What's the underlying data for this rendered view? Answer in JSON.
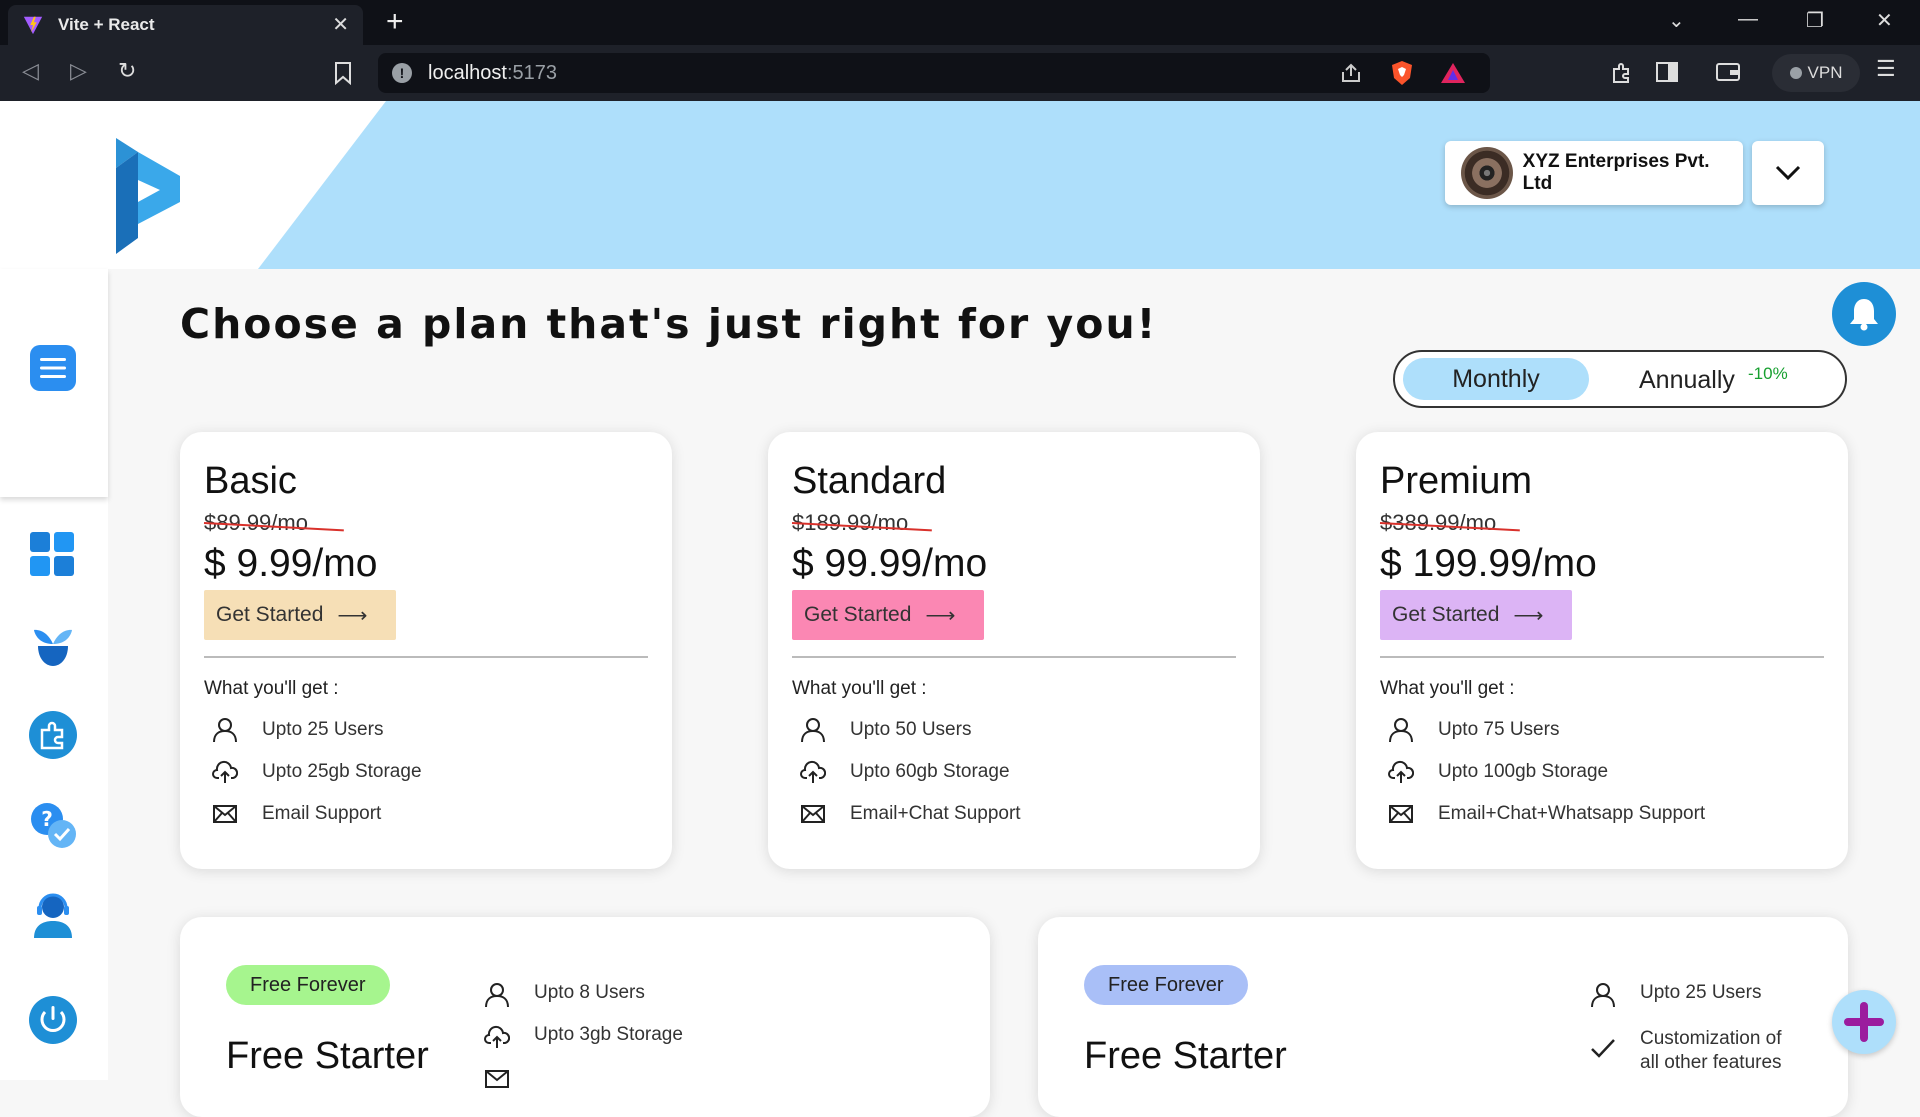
{
  "browser": {
    "tab_title": "Vite + React",
    "url_host": "localhost",
    "url_port": ":5173",
    "vpn_label": "VPN"
  },
  "header": {
    "company_name": "XYZ Enterprises Pvt. Ltd"
  },
  "sidebar": {
    "items": [
      {
        "icon": "menu-icon"
      },
      {
        "icon": "dashboard-icon"
      },
      {
        "icon": "plant-icon"
      },
      {
        "icon": "puzzle-icon"
      },
      {
        "icon": "help-chat-icon"
      },
      {
        "icon": "support-agent-icon"
      },
      {
        "icon": "power-icon"
      }
    ]
  },
  "main": {
    "headline": "Choose a plan that's just right for you!",
    "billing_toggle": {
      "monthly": "Monthly",
      "annually": "Annually",
      "discount": "-10%",
      "selected": "Monthly"
    },
    "plans": [
      {
        "name": "Basic",
        "old_price": "$89.99/mo",
        "price": "$ 9.99/mo",
        "cta": "Get Started",
        "cta_color": "#f6dfb6",
        "what_you_get": "What you'll get :",
        "features": [
          {
            "icon": "user-icon",
            "text": "Upto 25 Users"
          },
          {
            "icon": "cloud-upload-icon",
            "text": "Upto 25gb Storage"
          },
          {
            "icon": "mail-icon",
            "text": "Email Support"
          }
        ]
      },
      {
        "name": "Standard",
        "old_price": "$189.99/mo",
        "price": "$ 99.99/mo",
        "cta": "Get Started",
        "cta_color": "#fb87b3",
        "what_you_get": "What you'll get :",
        "features": [
          {
            "icon": "user-icon",
            "text": "Upto 50 Users"
          },
          {
            "icon": "cloud-upload-icon",
            "text": "Upto 60gb Storage"
          },
          {
            "icon": "mail-icon",
            "text": "Email+Chat Support"
          }
        ]
      },
      {
        "name": "Premium",
        "old_price": "$389.99/mo",
        "price": "$ 199.99/mo",
        "cta": "Get Started",
        "cta_color": "#dcb4f5",
        "what_you_get": "What you'll get :",
        "features": [
          {
            "icon": "user-icon",
            "text": "Upto 75 Users"
          },
          {
            "icon": "cloud-upload-icon",
            "text": "Upto 100gb Storage"
          },
          {
            "icon": "mail-icon",
            "text": "Email+Chat+Whatsapp Support"
          }
        ]
      }
    ],
    "free_plans": [
      {
        "badge": "Free Forever",
        "badge_color": "#a6f58e",
        "title": "Free Starter",
        "features": [
          {
            "icon": "user-icon",
            "text": "Upto 8 Users"
          },
          {
            "icon": "cloud-upload-icon",
            "text": "Upto 3gb Storage"
          }
        ]
      },
      {
        "badge": "Free Forever",
        "badge_color": "#a9bff7",
        "title": "Free Starter",
        "features": [
          {
            "icon": "user-icon",
            "text": "Upto 25 Users"
          },
          {
            "icon": "check-icon",
            "text": "Customization of all other features"
          }
        ]
      }
    ]
  },
  "colors": {
    "header_bg": "#aedffb",
    "accent_blue": "#1e8fd6",
    "fab_plus": "#9b1c9e"
  }
}
